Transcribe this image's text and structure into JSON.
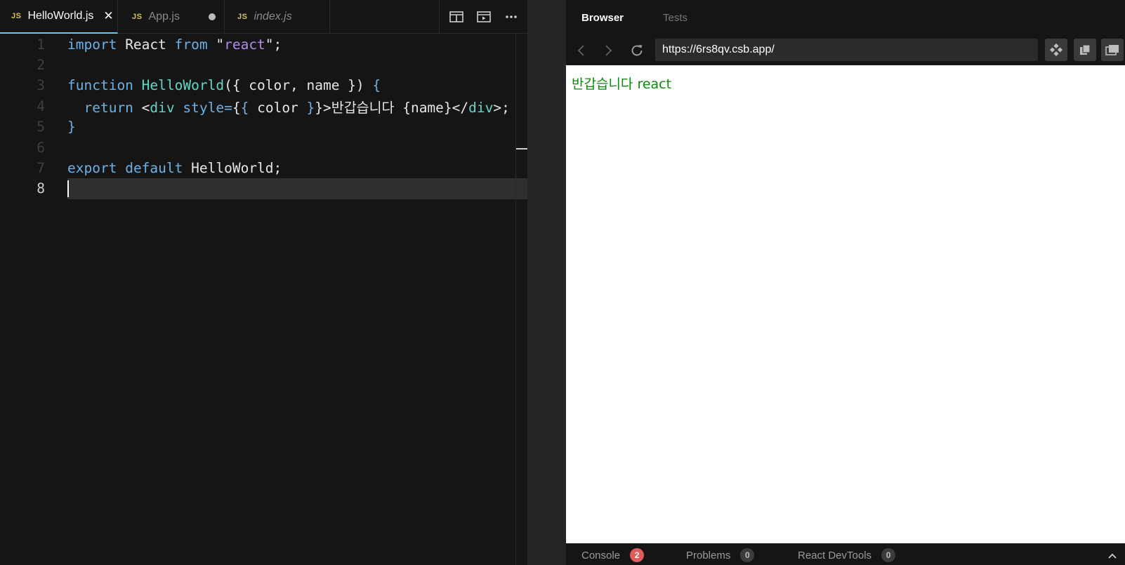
{
  "editor": {
    "tabs": [
      {
        "label": "HelloWorld.js",
        "badge": "JS",
        "state": "active"
      },
      {
        "label": "App.js",
        "badge": "JS",
        "state": "modified"
      },
      {
        "label": "index.js",
        "badge": "JS",
        "state": "preview"
      }
    ],
    "tools": [
      "split-editor-icon",
      "open-preview-icon",
      "more-icon"
    ],
    "lines": [
      {
        "n": "1",
        "tokens": [
          [
            "kw",
            "import"
          ],
          [
            "pl",
            " React "
          ],
          [
            "kw",
            "from"
          ],
          [
            "pl",
            " \""
          ],
          [
            "str",
            "react"
          ],
          [
            "pl",
            "\";"
          ]
        ]
      },
      {
        "n": "2",
        "tokens": []
      },
      {
        "n": "3",
        "tokens": [
          [
            "kw",
            "function"
          ],
          [
            "pl",
            " "
          ],
          [
            "fn",
            "HelloWorld"
          ],
          [
            "pl",
            "({ color, name }) "
          ],
          [
            "brace",
            "{"
          ]
        ]
      },
      {
        "n": "4",
        "tokens": [
          [
            "pl",
            "  "
          ],
          [
            "kw",
            "return"
          ],
          [
            "pl",
            " <"
          ],
          [
            "tag",
            "div"
          ],
          [
            "pl",
            " "
          ],
          [
            "attr",
            "style"
          ],
          [
            "brace",
            "="
          ],
          [
            "pl",
            "{"
          ],
          [
            "brace",
            "{"
          ],
          [
            "pl",
            " color "
          ],
          [
            "brace",
            "}"
          ],
          [
            "pl",
            "}>반갑습니다 {name}</"
          ],
          [
            "tag",
            "div"
          ],
          [
            "pl",
            ">;"
          ]
        ]
      },
      {
        "n": "5",
        "tokens": [
          [
            "brace",
            "}"
          ]
        ]
      },
      {
        "n": "6",
        "tokens": []
      },
      {
        "n": "7",
        "tokens": [
          [
            "kw",
            "export"
          ],
          [
            "pl",
            " "
          ],
          [
            "kw",
            "default"
          ],
          [
            "pl",
            " HelloWorld;"
          ]
        ]
      },
      {
        "n": "8",
        "tokens": []
      }
    ],
    "current_line": "8"
  },
  "preview": {
    "tabs": [
      {
        "label": "Browser",
        "state": "active"
      },
      {
        "label": "Tests",
        "state": "inactive"
      }
    ],
    "url": "https://6rs8qv.csb.app/",
    "page_text": "반갑습니다 react",
    "page_text_color": "#0a8a0a",
    "devtools": [
      {
        "label": "Console",
        "count": "2",
        "color": "red"
      },
      {
        "label": "Problems",
        "count": "0",
        "color": "grey"
      },
      {
        "label": "React DevTools",
        "count": "0",
        "color": "grey"
      }
    ]
  },
  "colors": {
    "background": "#151515",
    "accent": "#6cc7f6",
    "keyword": "#6cb1e6",
    "function": "#62d6c4",
    "string": "#b28bea"
  }
}
